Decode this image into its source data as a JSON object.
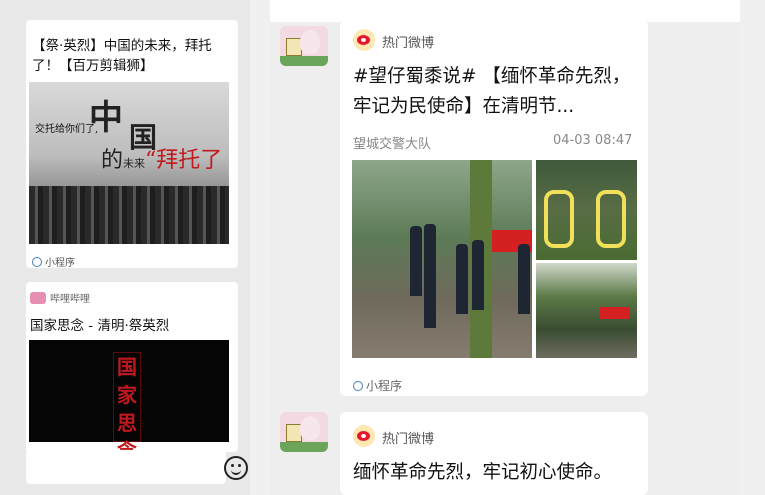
{
  "left": {
    "card1": {
      "title": "【祭·英烈】中国的未来，拜托了！【百万剪辑狮】",
      "poster": {
        "big1": "中",
        "big2": "国",
        "small": "交托给你们了,",
        "phrase_prefix": "的",
        "phrase_mid": "未来",
        "phrase_red": "“拜托了"
      },
      "mini_program_label": "小程序"
    },
    "card2": {
      "source_name": "哔哩哔哩",
      "title": "国家思念 - 清明·祭英烈",
      "poster_text": "国家思念"
    }
  },
  "right": {
    "post1": {
      "account_name": "热门微博",
      "title": "#望仔蜀黍说# 【缅怀革命先烈，牢记为民使命】在清明节...",
      "source": "望城交警大队",
      "time": "04-03 08:47",
      "mini_program_label": "小程序"
    },
    "post2": {
      "account_name": "热门微博",
      "title": "缅怀革命先烈，牢记初心使命。"
    }
  },
  "colors": {
    "weibo_red": "#e6162d",
    "bilibili_pink": "#e68fb3",
    "link_blue": "#4a7fb8"
  }
}
